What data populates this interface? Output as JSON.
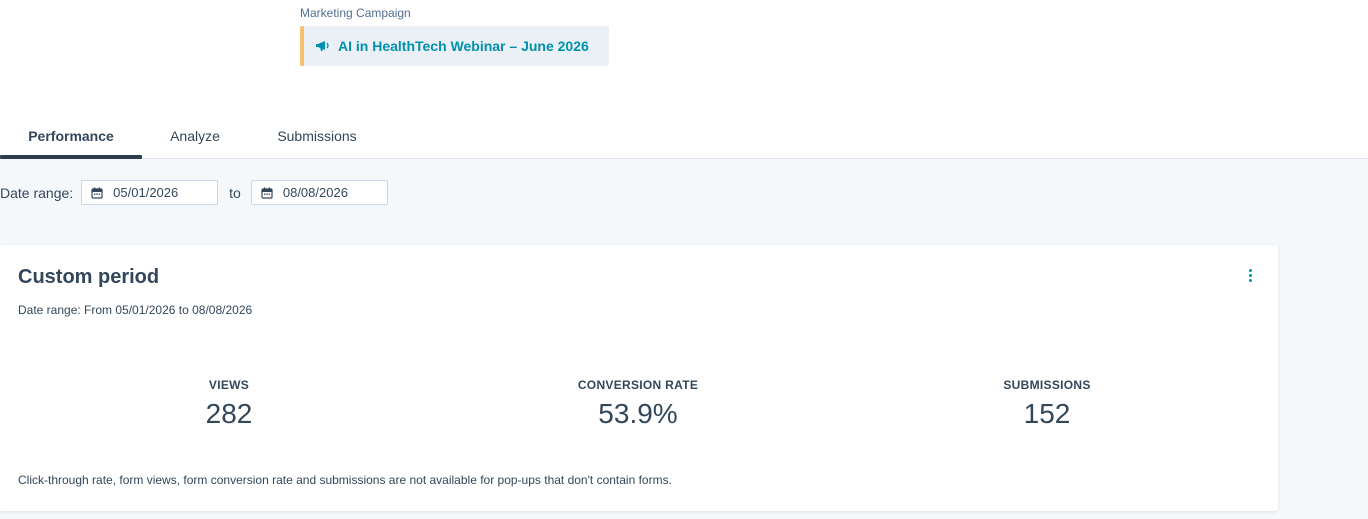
{
  "campaign": {
    "label": "Marketing Campaign",
    "name": "AI in HealthTech Webinar – June 2026",
    "icon": "megaphone-icon",
    "accent_color": "#f5c26b",
    "link_color": "#0091ae"
  },
  "tabs": [
    {
      "label": "Performance",
      "active": true
    },
    {
      "label": "Analyze",
      "active": false
    },
    {
      "label": "Submissions",
      "active": false
    }
  ],
  "date_range": {
    "label": "Date range:",
    "start": "05/01/2026",
    "separator": "to",
    "end": "08/08/2026"
  },
  "card": {
    "title": "Custom period",
    "subtitle": "Date range: From 05/01/2026 to 08/08/2026",
    "stats": [
      {
        "label": "VIEWS",
        "value": "282"
      },
      {
        "label": "CONVERSION RATE",
        "value": "53.9%"
      },
      {
        "label": "SUBMISSIONS",
        "value": "152"
      }
    ],
    "note": "Click-through rate, form views, form conversion rate and submissions are not available for pop-ups that don't contain forms."
  }
}
